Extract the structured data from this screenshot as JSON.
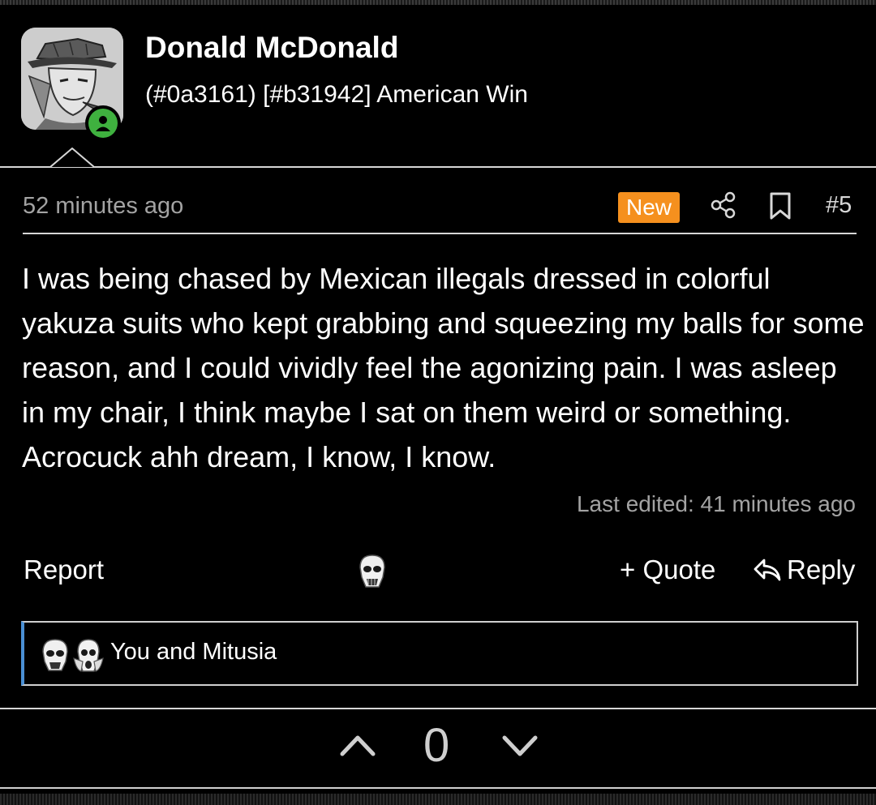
{
  "author": {
    "name": "Donald McDonald",
    "title": "(#0a3161) [#b31942] American Win",
    "status": "online"
  },
  "post": {
    "timestamp": "52 minutes ago",
    "badge": "New",
    "number": "#5",
    "body": "I was being chased by Mexican illegals dressed in colorful yakuza suits who kept grabbing and squeezing my balls for some reason, and I could vividly feel the agonizing pain. I was asleep in my chair, I think maybe I sat on them weird or something. Acrocuck ahh dream, I know, I know.",
    "last_edited": "Last edited: 41 minutes ago"
  },
  "actions": {
    "report": "Report",
    "quote": "+ Quote",
    "reply": "Reply"
  },
  "reactions": {
    "names": "You and Mitusia"
  },
  "votes": {
    "count": "0"
  },
  "colors": {
    "badge_new": "#f5901e",
    "online": "#3fb13f",
    "reaction_accent": "#4a8fd4"
  },
  "icons": [
    "share-icon",
    "bookmark-icon",
    "reply-arrow-icon",
    "reaction-face-icon",
    "vote-up-icon",
    "vote-down-icon",
    "online-status-icon"
  ]
}
